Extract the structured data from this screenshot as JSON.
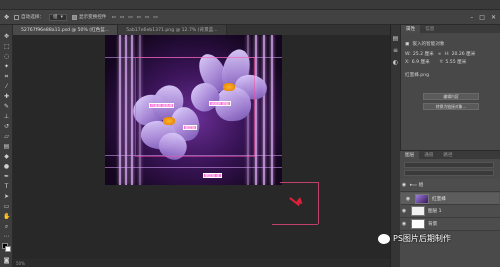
{
  "options_bar": {
    "auto_select_label": "自动选择：",
    "auto_select_value": "组",
    "show_transform_label": "显示变换控件"
  },
  "tabs": [
    {
      "label": "52767f96e88a11.psd @ 50% (红色蓝...",
      "active": true
    },
    {
      "label": "5ab17e6eb1371.png @ 12.7% (背景蓝...",
      "active": false
    }
  ],
  "properties_panel": {
    "tabs": [
      "属性",
      "信息"
    ],
    "section_title": "嵌入的智能对象",
    "w_label": "W:",
    "w_value": "25.2 厘米",
    "h_label": "H:",
    "h_value": "20.26 厘米",
    "x_label": "X:",
    "x_value": "6.9 厘米",
    "y_label": "Y:",
    "y_value": "5.55 厘米",
    "file_name": "红蜜蜂.png",
    "edit_contents_button": "编辑内容",
    "convert_button": "转换为链接对象..."
  },
  "layers_panel": {
    "tabs": [
      "图层",
      "通道",
      "路径"
    ],
    "layers": [
      {
        "name": "组",
        "thumb": "mix"
      },
      {
        "name": "红蜜蜂",
        "thumb": "img",
        "selected": true
      },
      {
        "name": "图层 1",
        "thumb": "white"
      },
      {
        "name": "背景",
        "thumb": "bg"
      }
    ]
  },
  "canvas": {
    "labels": [
      "作者蓝 纯色蓝",
      "品图底 图蓝",
      "图层蓝",
      "图层蓝 蓝"
    ]
  },
  "status_bar": {
    "zoom": "50%"
  },
  "watermark": {
    "text": "PS图片后期制作"
  },
  "icons": {
    "tools": [
      "move-icon",
      "marquee-icon",
      "lasso-icon",
      "wand-icon",
      "crop-icon",
      "eyedropper-icon",
      "heal-icon",
      "brush-icon",
      "stamp-icon",
      "history-icon",
      "eraser-icon",
      "gradient-icon",
      "blur-icon",
      "dodge-icon",
      "pen-icon",
      "type-icon",
      "path-select-icon",
      "shape-icon",
      "hand-icon",
      "zoom-icon"
    ]
  }
}
